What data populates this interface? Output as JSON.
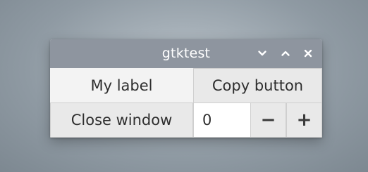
{
  "window": {
    "title": "gtktest",
    "controls": {
      "minimize_icon": "chevron-down-icon",
      "maximize_icon": "chevron-up-icon",
      "close_icon": "close-icon"
    }
  },
  "content": {
    "label_text": "My label",
    "copy_button_label": "Copy button",
    "close_button_label": "Close window",
    "spin_value": "0",
    "decrement_label": "−",
    "increment_label": "+"
  },
  "colors": {
    "titlebar": "#8e959f",
    "window_bg": "#f0f0f0",
    "button_bg": "#e9e9e9",
    "entry_bg": "#ffffff"
  }
}
